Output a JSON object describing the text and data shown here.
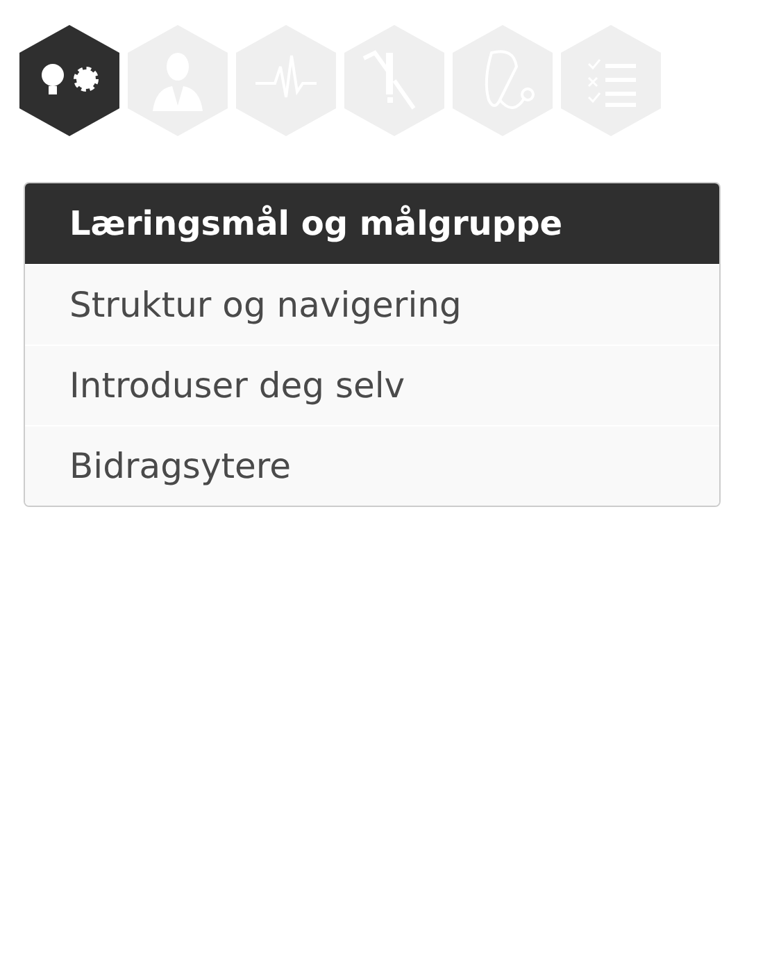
{
  "tabs": [
    {
      "kind": "ideas",
      "selected": true
    },
    {
      "kind": "person",
      "selected": false
    },
    {
      "kind": "pulse",
      "selected": false
    },
    {
      "kind": "tools",
      "selected": false
    },
    {
      "kind": "stethoscope",
      "selected": false
    },
    {
      "kind": "checklist",
      "selected": false
    }
  ],
  "menu": [
    {
      "label": "Læringsmål og målgruppe",
      "selected": true
    },
    {
      "label": "Struktur og navigering",
      "selected": false
    },
    {
      "label": "Introduser deg selv",
      "selected": false
    },
    {
      "label": "Bidragsytere",
      "selected": false
    }
  ]
}
